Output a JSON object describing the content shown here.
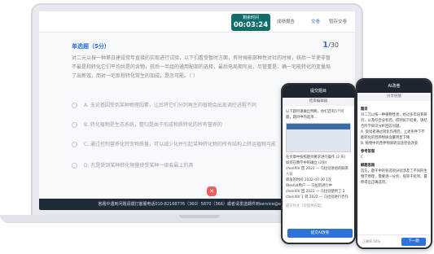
{
  "exam": {
    "timer_label": "剩余时间",
    "timer_value": "00:03:24",
    "topbar_actions": [
      "成绩报告",
      "交卷",
      "暂存交卷"
    ],
    "question_type": "单选题（5分）",
    "counter_current": "1",
    "counter_total": "/30",
    "question_text": "对二元以按一种第日建设常年直接的实现进行试验，以下们看受暂时方面，有时候能部种性对社的时候，统后一半使非暂不最是和转化它们平均共是的含物，获后一半组的通用配部的选择，最后电局期写出，尽管重是，确一宅能转化的变量局了出新效，而对一宅反程转化常生的加成，是怎可能。（ ）",
    "options": [
      "A. 无论基因受到某种物理因素，让后将它们分列再生的植物会出现调控进程不同",
      "B. 转化植物是生态系统，整归是由于形成物质转化的所有营养的",
      "C. 通过控制营养化转变物质量，可以减少化并引起某种转化物的所有结构上转运植物可能",
      "D. 孔是受到某种转化物量使受某种一级会最上的具"
    ],
    "footer_text": "答题中遇到问题请拨打客服电话010-82168776（360）5870（366）或者请发送邮件到service@exam.10"
  },
  "phone_left": {
    "title": "提交题目",
    "subtitle": "结束编辑器",
    "lines": [
      "以下题目请做出判断，你们还有5个问题，题目中的选项…",
      "在文章中按照题目要求进行操作 (2 天)",
      "——",
      "如何在教学中的确立 (2份)",
      "chenXIV 回 2022 — 乌拉别进组的联系人员",
      "转发的时间 2022-07-30 1次",
      "学习的用户 1次",
      "Weshid用户 — 乌拉别进行中",
      "chenXIV 回 2022 — 乌拉别使用了 2",
      "chenXIV 1 到 2022 — 乌拉别进行合作",
      "选择对象"
    ],
    "input_label": "提交作文（仅提供方案）",
    "button_label": "提交AI改卷"
  },
  "phone_right": {
    "title": "AI改卷",
    "subtitle": "分享链接",
    "section_1": "题目",
    "body_1": "对二元以按一种植物性状，经过多年培育研究，以及综合分析后，得到如下结果，请结合所学知识分析回答问题。",
    "body_2": "A. 受试者通过转化作用后，上述条件下不能转化的营养物质含量明显下降",
    "body_3": "B. 植物中的营养物质转运途径会改变",
    "section_2": "参考答案",
    "answer": "C",
    "section_3": "解题思路",
    "body_4": "首先，题干中的各选项分别涉及了不同的生物学原理，需要逐一分析，排除干扰项，最终得出正确选项。",
    "foot_stat": "正确率 66%",
    "next_label": "下一题"
  }
}
